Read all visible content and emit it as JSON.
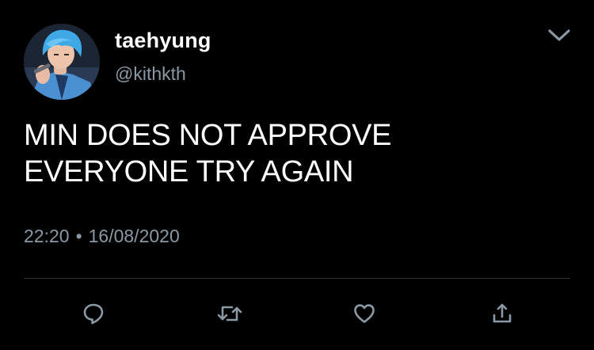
{
  "tweet": {
    "author": {
      "display_name": "taehyung",
      "handle": "@kithkth",
      "avatar_icon": "profile-photo"
    },
    "menu_icon": "chevron-down-icon",
    "text_lines": [
      "MIN DOES NOT APPROVE",
      "EVERYONE TRY AGAIN"
    ],
    "time": "22:20",
    "separator": "•",
    "date": "16/08/2020",
    "actions": [
      {
        "name": "reply",
        "icon": "reply-icon"
      },
      {
        "name": "retweet",
        "icon": "retweet-icon"
      },
      {
        "name": "like",
        "icon": "heart-icon"
      },
      {
        "name": "share",
        "icon": "share-icon"
      }
    ]
  },
  "colors": {
    "background": "#000000",
    "primary_text": "#ffffff",
    "secondary_text": "#8b98a5",
    "divider": "#2f3336",
    "avatar_hair": "#3fa9e6"
  }
}
